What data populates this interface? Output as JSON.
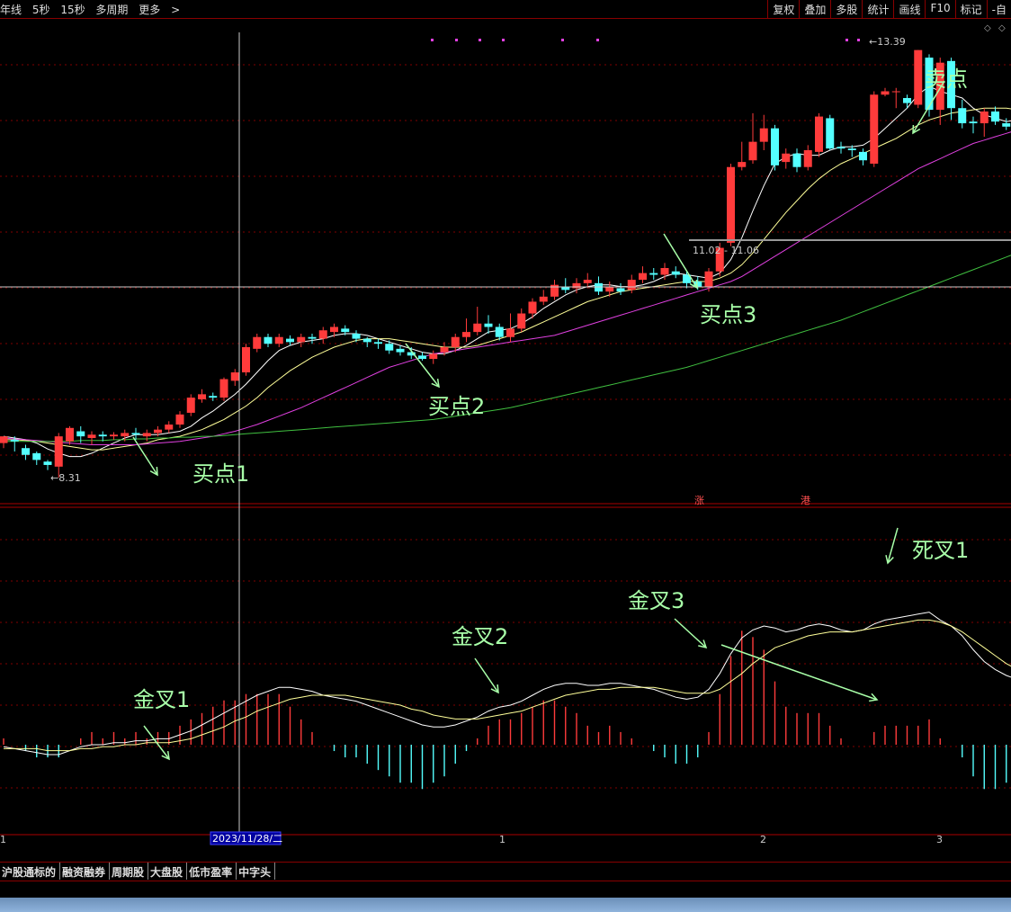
{
  "toolbar": {
    "left_items": [
      "年线",
      "5秒",
      "15秒",
      "多周期",
      "更多"
    ],
    "right_items": [
      "复权",
      "叠加",
      "多股",
      "统计",
      "画线",
      "F10",
      "标记",
      "-自"
    ]
  },
  "chart_data": [
    {
      "type": "candlestick",
      "panel": "price",
      "ylim": [
        8.0,
        13.6
      ],
      "candles": [
        [
          8.72,
          8.8,
          8.66,
          8.78
        ],
        [
          8.76,
          8.74,
          8.62,
          8.8
        ],
        [
          8.66,
          8.58,
          8.52,
          8.7
        ],
        [
          8.6,
          8.52,
          8.46,
          8.62
        ],
        [
          8.5,
          8.46,
          8.4,
          8.52
        ],
        [
          8.44,
          8.8,
          8.31,
          8.84
        ],
        [
          8.74,
          8.9,
          8.7,
          8.92
        ],
        [
          8.86,
          8.8,
          8.72,
          8.92
        ],
        [
          8.78,
          8.82,
          8.7,
          8.86
        ],
        [
          8.82,
          8.8,
          8.74,
          8.86
        ],
        [
          8.8,
          8.82,
          8.76,
          8.85
        ],
        [
          8.8,
          8.84,
          8.74,
          8.88
        ],
        [
          8.84,
          8.82,
          8.76,
          8.9
        ],
        [
          8.8,
          8.84,
          8.74,
          8.88
        ],
        [
          8.84,
          8.88,
          8.8,
          8.92
        ],
        [
          8.88,
          8.94,
          8.84,
          8.98
        ],
        [
          8.94,
          9.06,
          8.9,
          9.1
        ],
        [
          9.08,
          9.26,
          9.04,
          9.3
        ],
        [
          9.24,
          9.3,
          9.2,
          9.36
        ],
        [
          9.28,
          9.26,
          9.22,
          9.32
        ],
        [
          9.26,
          9.48,
          9.22,
          9.5
        ],
        [
          9.46,
          9.56,
          9.4,
          9.6
        ],
        [
          9.56,
          9.86,
          9.52,
          9.9
        ],
        [
          9.84,
          9.98,
          9.8,
          10.02
        ],
        [
          9.98,
          9.9,
          9.86,
          10.02
        ],
        [
          9.9,
          9.98,
          9.86,
          10.02
        ],
        [
          9.96,
          9.92,
          9.88,
          10.0
        ],
        [
          9.92,
          9.98,
          9.86,
          10.02
        ],
        [
          9.98,
          9.96,
          9.9,
          10.02
        ],
        [
          9.96,
          10.06,
          9.9,
          10.1
        ],
        [
          10.04,
          10.1,
          9.98,
          10.14
        ],
        [
          10.08,
          10.04,
          10.0,
          10.12
        ],
        [
          10.02,
          9.96,
          9.92,
          10.06
        ],
        [
          9.96,
          9.92,
          9.86,
          9.98
        ],
        [
          9.92,
          9.9,
          9.84,
          9.96
        ],
        [
          9.9,
          9.82,
          9.78,
          9.94
        ],
        [
          9.84,
          9.8,
          9.76,
          9.88
        ],
        [
          9.8,
          9.76,
          9.72,
          9.86
        ],
        [
          9.76,
          9.72,
          9.7,
          9.8
        ],
        [
          9.72,
          9.78,
          9.66,
          9.82
        ],
        [
          9.8,
          9.86,
          9.76,
          9.92
        ],
        [
          9.86,
          9.98,
          9.8,
          10.02
        ],
        [
          9.98,
          10.04,
          9.92,
          10.2
        ],
        [
          10.04,
          10.14,
          10.0,
          10.34
        ],
        [
          10.14,
          10.1,
          10.02,
          10.24
        ],
        [
          10.1,
          9.98,
          9.94,
          10.14
        ],
        [
          9.98,
          10.08,
          9.92,
          10.26
        ],
        [
          10.08,
          10.26,
          10.04,
          10.32
        ],
        [
          10.26,
          10.4,
          10.2,
          10.44
        ],
        [
          10.4,
          10.46,
          10.36,
          10.54
        ],
        [
          10.46,
          10.6,
          10.42,
          10.66
        ],
        [
          10.58,
          10.54,
          10.5,
          10.68
        ],
        [
          10.56,
          10.62,
          10.5,
          10.68
        ],
        [
          10.62,
          10.66,
          10.56,
          10.74
        ],
        [
          10.62,
          10.52,
          10.48,
          10.7
        ],
        [
          10.52,
          10.58,
          10.46,
          10.64
        ],
        [
          10.56,
          10.52,
          10.48,
          10.62
        ],
        [
          10.54,
          10.66,
          10.5,
          10.72
        ],
        [
          10.66,
          10.74,
          10.62,
          10.82
        ],
        [
          10.74,
          10.72,
          10.66,
          10.8
        ],
        [
          10.72,
          10.8,
          10.66,
          10.86
        ],
        [
          10.76,
          10.72,
          10.68,
          10.82
        ],
        [
          10.72,
          10.62,
          10.56,
          10.76
        ],
        [
          10.64,
          10.58,
          10.54,
          10.7
        ],
        [
          10.58,
          10.76,
          10.52,
          10.8
        ],
        [
          10.76,
          11.04,
          10.7,
          11.1
        ],
        [
          11.1,
          12.0,
          11.06,
          12.04
        ],
        [
          12.0,
          12.06,
          11.96,
          12.3
        ],
        [
          12.08,
          12.3,
          12.04,
          12.64
        ],
        [
          12.3,
          12.46,
          12.2,
          12.62
        ],
        [
          12.46,
          12.02,
          11.96,
          12.5
        ],
        [
          12.06,
          12.16,
          11.98,
          12.22
        ],
        [
          12.16,
          12.0,
          11.94,
          12.22
        ],
        [
          12.0,
          12.2,
          11.96,
          12.26
        ],
        [
          12.18,
          12.6,
          12.12,
          12.64
        ],
        [
          12.58,
          12.22,
          12.2,
          12.62
        ],
        [
          12.24,
          12.22,
          12.16,
          12.3
        ],
        [
          12.22,
          12.2,
          12.12,
          12.26
        ],
        [
          12.18,
          12.08,
          12.02,
          12.22
        ],
        [
          12.04,
          12.86,
          12.0,
          12.9
        ],
        [
          12.86,
          12.9,
          12.84,
          12.94
        ],
        [
          12.9,
          12.9,
          12.7,
          12.94
        ],
        [
          12.82,
          12.76,
          12.7,
          12.86
        ],
        [
          12.74,
          13.39,
          12.7,
          13.39
        ],
        [
          13.3,
          12.68,
          12.6,
          13.34
        ],
        [
          12.68,
          13.24,
          12.5,
          13.3
        ],
        [
          13.26,
          12.7,
          12.56,
          13.3
        ],
        [
          12.7,
          12.52,
          12.46,
          12.8
        ],
        [
          12.54,
          12.52,
          12.4,
          12.6
        ],
        [
          12.52,
          12.66,
          12.36,
          12.7
        ],
        [
          12.66,
          12.54,
          12.5,
          12.72
        ],
        [
          12.52,
          12.48,
          12.44,
          12.58
        ],
        [
          12.5,
          12.76,
          12.44,
          12.82
        ],
        [
          12.76,
          12.72,
          12.66,
          12.86
        ],
        [
          12.7,
          12.76,
          12.64,
          12.82
        ],
        [
          12.76,
          12.8,
          12.7,
          12.86
        ],
        [
          12.78,
          12.66,
          12.6,
          12.86
        ],
        [
          12.66,
          12.22,
          12.16,
          12.7
        ]
      ],
      "ma_lines": [
        {
          "name": "MA5",
          "color": "#ffffff",
          "values": [
            8.8,
            8.78,
            8.76,
            8.72,
            8.65,
            8.6,
            8.56,
            8.56,
            8.6,
            8.66,
            8.72,
            8.78,
            8.82,
            8.82,
            8.82,
            8.84,
            8.86,
            8.92,
            9.02,
            9.1,
            9.2,
            9.3,
            9.42,
            9.56,
            9.7,
            9.82,
            9.88,
            9.92,
            9.94,
            9.96,
            10.0,
            10.02,
            10.02,
            10.0,
            9.96,
            9.92,
            9.88,
            9.84,
            9.8,
            9.78,
            9.78,
            9.82,
            9.88,
            9.96,
            10.04,
            10.06,
            10.08,
            10.14,
            10.22,
            10.32,
            10.4,
            10.48,
            10.54,
            10.58,
            10.6,
            10.6,
            10.58,
            10.58,
            10.6,
            10.64,
            10.7,
            10.74,
            10.72,
            10.7,
            10.68,
            10.74,
            10.9,
            11.16,
            11.48,
            11.78,
            12.04,
            12.12,
            12.16,
            12.14,
            12.14,
            12.2,
            12.24,
            12.24,
            12.26,
            12.34,
            12.46,
            12.58,
            12.7,
            12.86,
            12.96,
            12.9,
            12.86,
            12.82,
            12.7,
            12.62,
            12.58,
            12.54,
            12.56,
            12.62,
            12.66,
            12.7,
            12.74,
            12.64
          ]
        },
        {
          "name": "MA10",
          "color": "#ffff99",
          "values": [
            8.76,
            8.76,
            8.75,
            8.74,
            8.72,
            8.7,
            8.68,
            8.66,
            8.64,
            8.64,
            8.66,
            8.68,
            8.7,
            8.72,
            8.76,
            8.78,
            8.8,
            8.84,
            8.88,
            8.94,
            9.0,
            9.08,
            9.16,
            9.26,
            9.38,
            9.48,
            9.58,
            9.66,
            9.74,
            9.8,
            9.86,
            9.9,
            9.94,
            9.96,
            9.96,
            9.96,
            9.94,
            9.92,
            9.9,
            9.88,
            9.86,
            9.86,
            9.86,
            9.88,
            9.92,
            9.96,
            10.0,
            10.04,
            10.1,
            10.16,
            10.22,
            10.28,
            10.34,
            10.4,
            10.44,
            10.48,
            10.52,
            10.54,
            10.56,
            10.58,
            10.6,
            10.62,
            10.64,
            10.64,
            10.64,
            10.68,
            10.74,
            10.84,
            10.98,
            11.14,
            11.3,
            11.46,
            11.6,
            11.74,
            11.86,
            11.96,
            12.04,
            12.1,
            12.16,
            12.22,
            12.28,
            12.34,
            12.42,
            12.5,
            12.56,
            12.6,
            12.64,
            12.66,
            12.68,
            12.7,
            12.7,
            12.7,
            12.68,
            12.66,
            12.66,
            12.66,
            12.64,
            12.6
          ]
        },
        {
          "name": "MA20",
          "color": "#e040e0",
          "values": [
            8.78,
            8.77,
            8.76,
            8.75,
            8.74,
            8.73,
            8.72,
            8.71,
            8.7,
            8.7,
            8.7,
            8.7,
            8.7,
            8.71,
            8.72,
            8.73,
            8.74,
            8.76,
            8.78,
            8.8,
            8.83,
            8.86,
            8.9,
            8.94,
            8.99,
            9.04,
            9.09,
            9.14,
            9.2,
            9.26,
            9.32,
            9.38,
            9.44,
            9.5,
            9.56,
            9.62,
            9.66,
            9.7,
            9.74,
            9.78,
            9.8,
            9.82,
            9.84,
            9.86,
            9.88,
            9.9,
            9.92,
            9.94,
            9.96,
            9.98,
            10.0,
            10.04,
            10.08,
            10.12,
            10.16,
            10.2,
            10.24,
            10.28,
            10.32,
            10.36,
            10.4,
            10.44,
            10.48,
            10.52,
            10.56,
            10.6,
            10.64,
            10.7,
            10.78,
            10.86,
            10.94,
            11.02,
            11.1,
            11.18,
            11.26,
            11.34,
            11.42,
            11.5,
            11.58,
            11.66,
            11.74,
            11.82,
            11.9,
            11.98,
            12.04,
            12.1,
            12.16,
            12.22,
            12.28,
            12.32,
            12.36,
            12.4,
            12.44,
            12.48,
            12.52,
            12.56,
            12.58,
            12.6
          ]
        },
        {
          "name": "MA60",
          "color": "#40c040",
          "values": [
            8.74,
            8.74,
            8.74,
            8.74,
            8.74,
            8.74,
            8.74,
            8.75,
            8.75,
            8.75,
            8.76,
            8.76,
            8.77,
            8.77,
            8.78,
            8.78,
            8.79,
            8.79,
            8.8,
            8.8,
            8.81,
            8.82,
            8.83,
            8.84,
            8.85,
            8.86,
            8.87,
            8.88,
            8.89,
            8.9,
            8.91,
            8.92,
            8.93,
            8.94,
            8.95,
            8.96,
            8.97,
            8.98,
            8.99,
            9.0,
            9.02,
            9.04,
            9.06,
            9.08,
            9.1,
            9.12,
            9.14,
            9.17,
            9.2,
            9.23,
            9.26,
            9.29,
            9.32,
            9.35,
            9.38,
            9.41,
            9.44,
            9.47,
            9.5,
            9.53,
            9.56,
            9.59,
            9.62,
            9.66,
            9.7,
            9.74,
            9.78,
            9.82,
            9.86,
            9.9,
            9.94,
            9.98,
            10.02,
            10.06,
            10.1,
            10.14,
            10.18,
            10.23,
            10.28,
            10.33,
            10.38,
            10.43,
            10.48,
            10.53,
            10.58,
            10.63,
            10.68,
            10.73,
            10.78,
            10.83,
            10.88,
            10.93,
            10.98,
            11.03,
            11.08,
            11.13,
            11.18,
            11.23
          ]
        }
      ],
      "annotations": [
        "买点1",
        "买点2",
        "买点3",
        "卖点"
      ],
      "price_labels": [
        "13.39",
        "8.31",
        "11.02 - 11.06"
      ],
      "markers": [
        "涨",
        "港"
      ]
    },
    {
      "type": "macd",
      "panel": "indicator",
      "ylim": [
        -1.0,
        1.0
      ],
      "dif": [
        -0.01,
        -0.02,
        -0.03,
        -0.04,
        -0.05,
        -0.05,
        -0.03,
        -0.01,
        0.0,
        0.0,
        0.01,
        0.01,
        0.02,
        0.02,
        0.03,
        0.03,
        0.05,
        0.07,
        0.1,
        0.13,
        0.16,
        0.19,
        0.22,
        0.25,
        0.27,
        0.29,
        0.29,
        0.28,
        0.27,
        0.25,
        0.24,
        0.23,
        0.22,
        0.2,
        0.18,
        0.16,
        0.14,
        0.12,
        0.1,
        0.09,
        0.09,
        0.1,
        0.12,
        0.14,
        0.17,
        0.19,
        0.2,
        0.22,
        0.25,
        0.28,
        0.3,
        0.31,
        0.31,
        0.3,
        0.3,
        0.31,
        0.31,
        0.3,
        0.29,
        0.28,
        0.26,
        0.24,
        0.23,
        0.24,
        0.28,
        0.36,
        0.46,
        0.54,
        0.58,
        0.6,
        0.59,
        0.57,
        0.58,
        0.6,
        0.61,
        0.6,
        0.58,
        0.57,
        0.58,
        0.61,
        0.63,
        0.64,
        0.65,
        0.66,
        0.67,
        0.63,
        0.6,
        0.55,
        0.48,
        0.42,
        0.38,
        0.35,
        0.33,
        0.3,
        0.27,
        0.24,
        0.21,
        0.15
      ],
      "dea": [
        -0.02,
        -0.02,
        -0.02,
        -0.02,
        -0.03,
        -0.03,
        -0.03,
        -0.02,
        -0.02,
        -0.01,
        -0.01,
        0.0,
        0.0,
        0.01,
        0.01,
        0.01,
        0.02,
        0.03,
        0.05,
        0.07,
        0.09,
        0.12,
        0.14,
        0.17,
        0.19,
        0.21,
        0.23,
        0.24,
        0.25,
        0.25,
        0.25,
        0.25,
        0.24,
        0.23,
        0.22,
        0.21,
        0.2,
        0.18,
        0.17,
        0.15,
        0.14,
        0.13,
        0.13,
        0.13,
        0.14,
        0.15,
        0.16,
        0.17,
        0.19,
        0.21,
        0.23,
        0.25,
        0.26,
        0.27,
        0.28,
        0.28,
        0.29,
        0.29,
        0.29,
        0.29,
        0.28,
        0.27,
        0.26,
        0.26,
        0.26,
        0.28,
        0.32,
        0.36,
        0.41,
        0.45,
        0.49,
        0.51,
        0.53,
        0.55,
        0.56,
        0.57,
        0.57,
        0.57,
        0.58,
        0.59,
        0.6,
        0.61,
        0.62,
        0.63,
        0.63,
        0.62,
        0.6,
        0.57,
        0.53,
        0.49,
        0.45,
        0.41,
        0.38,
        0.35,
        0.32,
        0.29,
        0.26,
        0.22
      ],
      "annotations": [
        "金叉1",
        "金叉2",
        "金叉3",
        "死叉1"
      ]
    }
  ],
  "axis": {
    "date_label": "2023/11/28/二",
    "month_labels": [
      "1",
      "1",
      "2",
      "3"
    ]
  },
  "bottom_tabs": [
    "沪股通标的",
    "融资融券",
    "周期股",
    "大盘股",
    "低市盈率",
    "中字头"
  ],
  "colors": {
    "up": "#ff3b3b",
    "down": "#54ffff",
    "grid": "#800000",
    "annotation": "#a8ffa8"
  }
}
